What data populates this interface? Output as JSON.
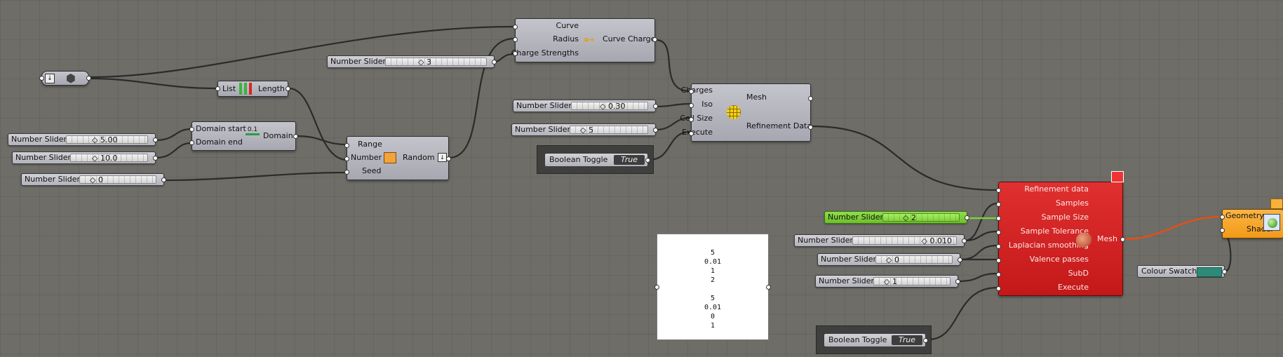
{
  "nodes": {
    "geometry_param": {
      "icons": [
        "down-arrow-icon",
        "hex-nut-icon"
      ]
    },
    "list_length": {
      "input": "List",
      "output": "Length"
    },
    "curve_charge": {
      "inputs": [
        "Curve",
        "Radius",
        "Charge Strengths"
      ],
      "output": "Curve Charge"
    },
    "domain": {
      "inputs": [
        "Domain start",
        "Domain end"
      ],
      "output": "Domain",
      "icon_text": "0.1"
    },
    "random": {
      "inputs": [
        "Range",
        "Number",
        "Seed"
      ],
      "output": "Random"
    },
    "mesh_component": {
      "inputs": [
        "Charges",
        "Iso",
        "Cell Size",
        "Execute"
      ],
      "outputs": [
        "Mesh",
        "Refinement Data"
      ]
    },
    "refine_component": {
      "inputs": [
        "Refinement data",
        "Samples",
        "Sample Size",
        "Sample Tolerance",
        "Laplacian smoothing",
        "Valence passes",
        "SubD",
        "Execute"
      ],
      "output": "Mesh"
    },
    "preview": {
      "inputs": [
        "Geometry",
        "Shader"
      ]
    },
    "colour_swatch": {
      "label": "Colour Swatch",
      "color": "#2d8a78"
    }
  },
  "sliders": [
    {
      "id": "slider-charge",
      "label": "Number Slider",
      "value": "3"
    },
    {
      "id": "slider-domain-start",
      "label": "Number Slider",
      "value": "5.00"
    },
    {
      "id": "slider-domain-end",
      "label": "Number Slider",
      "value": "10.0"
    },
    {
      "id": "slider-seed",
      "label": "Number Slider",
      "value": "0"
    },
    {
      "id": "slider-iso",
      "label": "Number Slider",
      "value": "0.30"
    },
    {
      "id": "slider-cellsize",
      "label": "Number Slider",
      "value": "5"
    },
    {
      "id": "slider-samples",
      "label": "Number Slider",
      "value": "2"
    },
    {
      "id": "slider-tolerance",
      "label": "Number Slider",
      "value": "0.010"
    },
    {
      "id": "slider-smoothing",
      "label": "Number Slider",
      "value": "0"
    },
    {
      "id": "slider-subd",
      "label": "Number Slider",
      "value": "1"
    }
  ],
  "toggles": [
    {
      "id": "toggle-mesh",
      "label": "Boolean Toggle",
      "state": "True"
    },
    {
      "id": "toggle-refine",
      "label": "Boolean Toggle",
      "state": "True"
    }
  ],
  "panel": {
    "lines": [
      "5",
      "0.01",
      "1",
      "2",
      "",
      "5",
      "0.01",
      "0",
      "1"
    ]
  },
  "colors": {
    "canvas": "#6e6d67",
    "wire": "#2b2b2b",
    "wire_green": "#7ccf3a",
    "wire_orange": "#e0501a",
    "red_component": "#d42222",
    "preview_component": "#f4a320"
  }
}
